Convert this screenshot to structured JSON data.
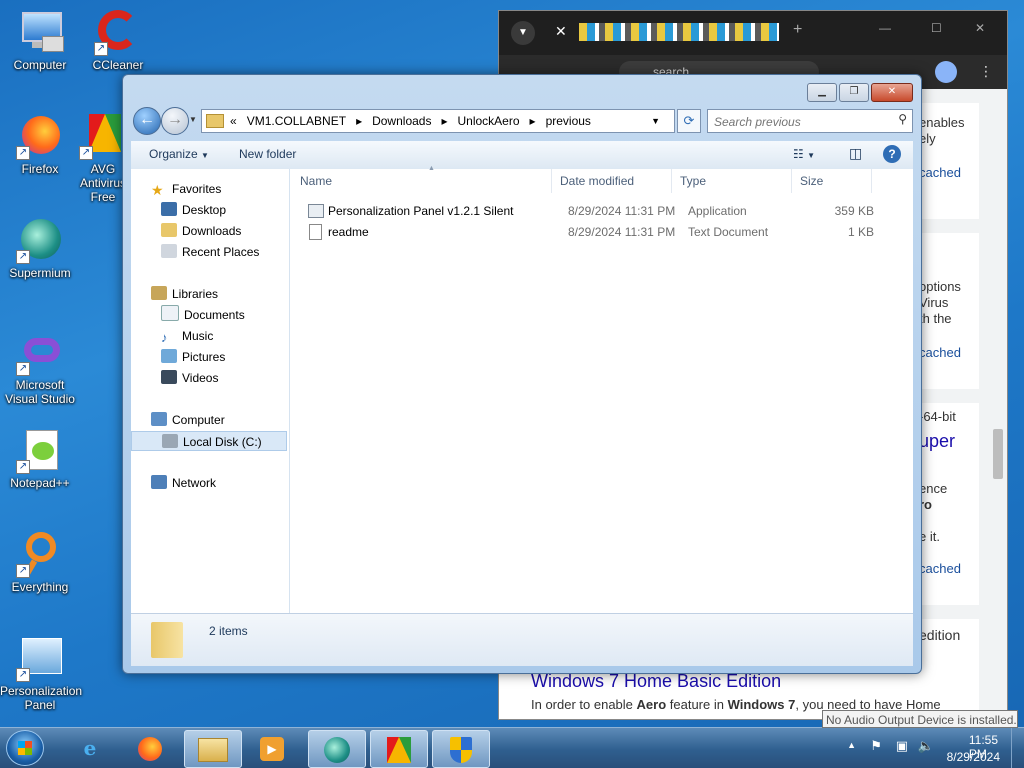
{
  "desktop": {
    "icons": [
      {
        "label": "Computer"
      },
      {
        "label": "CCleaner"
      },
      {
        "label": "Firefox"
      },
      {
        "label": "AVG Antivirus Free"
      },
      {
        "label": "Supermium"
      },
      {
        "label": "Microsoft Visual Studio"
      },
      {
        "label": "Notepad++"
      },
      {
        "label": "Everything"
      },
      {
        "label": "Personalization Panel"
      }
    ]
  },
  "browser": {
    "omnibox_text": "search",
    "snippets": [
      "enables",
      "ely",
      "cached",
      "options",
      "Virus",
      "th the",
      "cached",
      "-64-bit",
      "uper",
      "ence",
      "ro",
      "e it.",
      "cached",
      "edition"
    ],
    "result_title": "Windows 7 Home Basic Edition",
    "result_snippet_pre": "In order to enable ",
    "result_snippet_b1": "Aero",
    "result_snippet_mid": " feature in ",
    "result_snippet_b2": "Windows 7",
    "result_snippet_post": ", you need to have Home"
  },
  "explorer": {
    "breadcrumb_prefix": "«",
    "breadcrumb": [
      "VM1.COLLABNET",
      "Downloads",
      "UnlockAero",
      "previous"
    ],
    "search_placeholder": "Search previous",
    "toolbar": {
      "organize": "Organize",
      "new_folder": "New folder"
    },
    "nav": {
      "favorites": "Favorites",
      "desktop": "Desktop",
      "downloads": "Downloads",
      "recent": "Recent Places",
      "libraries": "Libraries",
      "documents": "Documents",
      "music": "Music",
      "pictures": "Pictures",
      "videos": "Videos",
      "computer": "Computer",
      "local_disk": "Local Disk (C:)",
      "network": "Network"
    },
    "columns": {
      "name": "Name",
      "date": "Date modified",
      "type": "Type",
      "size": "Size"
    },
    "files": [
      {
        "name": "Personalization Panel v1.2.1 Silent",
        "date": "8/29/2024 11:31 PM",
        "type": "Application",
        "size": "359 KB"
      },
      {
        "name": "readme",
        "date": "8/29/2024 11:31 PM",
        "type": "Text Document",
        "size": "1 KB"
      }
    ],
    "status": "2 items"
  },
  "taskbar": {
    "time": "11:55 PM",
    "date": "8/29/2024",
    "tooltip": "No Audio Output Device is installed."
  },
  "colors": {
    "desktop": "#1e78c8",
    "selection": "#cce8ff",
    "explorer_frame": "#a9c9ea"
  }
}
